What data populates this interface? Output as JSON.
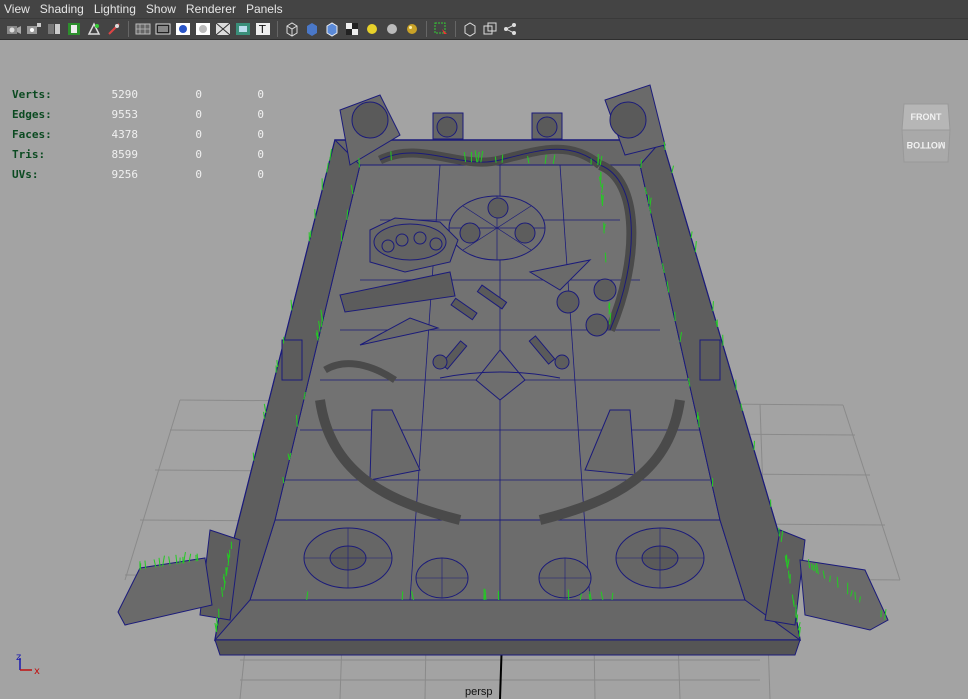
{
  "menu": [
    "View",
    "Shading",
    "Lighting",
    "Show",
    "Renderer",
    "Panels"
  ],
  "toolbar_icons": [
    "camera-select-icon",
    "camera-attributes-icon",
    "bookmark-icon",
    "image-plane-icon",
    "two-d-pan-zoom-icon",
    "grease-pencil-icon",
    "grid-icon",
    "film-gate-icon",
    "resolution-gate-icon",
    "gate-mask-icon",
    "field-chart-icon",
    "safe-action-icon",
    "safe-title-icon",
    "wireframe-icon",
    "smooth-shade-icon",
    "wireframe-on-shaded-icon",
    "textured-icon",
    "use-lights-icon",
    "shadows-icon",
    "high-quality-icon",
    "isolate-select-icon",
    "xray-icon",
    "xray-joints-icon",
    "bounding-box-icon"
  ],
  "hud": {
    "rows": [
      {
        "label": "Verts:",
        "v1": "5290",
        "v2": "0",
        "v3": "0"
      },
      {
        "label": "Edges:",
        "v1": "9553",
        "v2": "0",
        "v3": "0"
      },
      {
        "label": "Faces:",
        "v1": "4378",
        "v2": "0",
        "v3": "0"
      },
      {
        "label": "Tris:",
        "v1": "8599",
        "v2": "0",
        "v3": "0"
      },
      {
        "label": "UVs:",
        "v1": "9256",
        "v2": "0",
        "v3": "0"
      }
    ]
  },
  "viewcube": {
    "front": "FRONT",
    "bottom": "BOTTOM"
  },
  "axis": {
    "z": "z",
    "x": "x",
    "z_color": "#1a1ab0",
    "x_color": "#c01010"
  },
  "camera_label": "persp",
  "colors": {
    "menubar": "#444444",
    "viewport": "#a3a3a3",
    "mesh": "#676767",
    "wire": "#1b1b7a",
    "normals": "#22cc22",
    "hud_label": "#0b4a21"
  }
}
